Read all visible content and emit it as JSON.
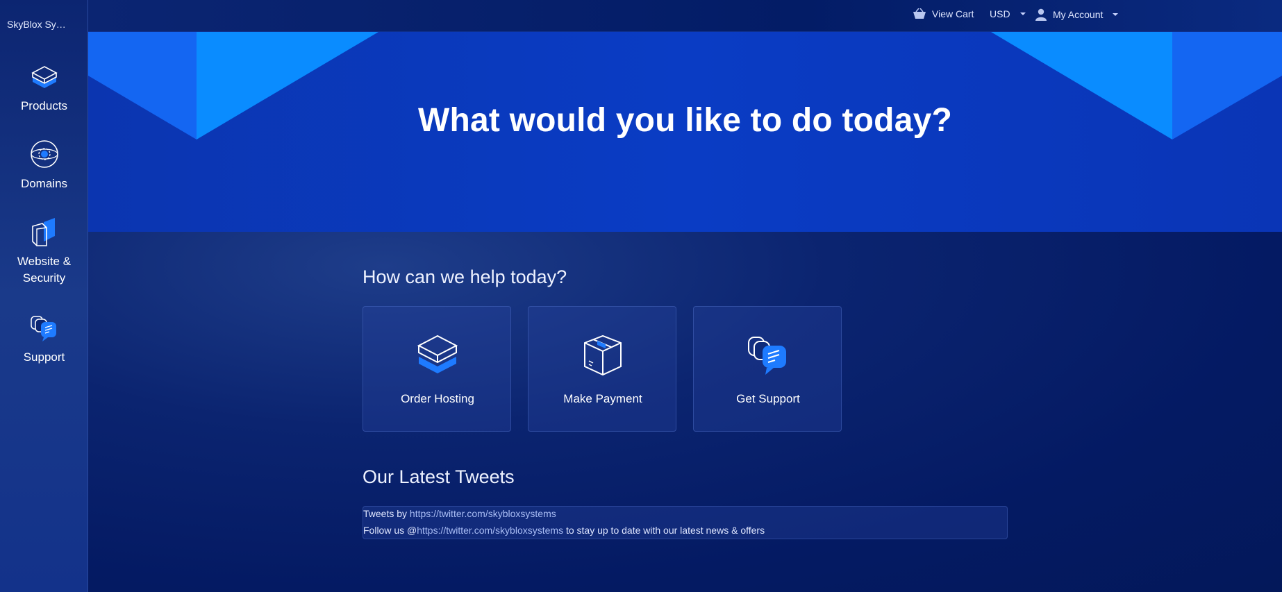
{
  "sidebar": {
    "brand": "SkyBlox Sy…",
    "items": [
      {
        "label": "Products",
        "icon": "box-icon"
      },
      {
        "label": "Domains",
        "icon": "globe-icon"
      },
      {
        "label": "Website &",
        "label2": "Security",
        "icon": "shield-book-icon"
      },
      {
        "label": "Support",
        "icon": "chat-bubbles-icon"
      }
    ]
  },
  "topbar": {
    "cart_label": "View Cart",
    "currency": "USD",
    "account_label": "My Account"
  },
  "hero": {
    "title": "What would you like to do today?"
  },
  "help": {
    "title": "How can we help today?",
    "cards": [
      {
        "label": "Order Hosting",
        "icon": "server-box-icon"
      },
      {
        "label": "Make Payment",
        "icon": "package-icon"
      },
      {
        "label": "Get Support",
        "icon": "chat-bubbles-icon"
      }
    ]
  },
  "tweets": {
    "title": "Our Latest Tweets",
    "line1_prefix": "Tweets by ",
    "line1_link": "https://twitter.com/skybloxsystems",
    "line2_prefix": "Follow us @",
    "line2_link": "https://twitter.com/skybloxsystems",
    "line2_suffix": " to stay up to date with our latest news & offers"
  },
  "colors": {
    "accent": "#0094ff",
    "hero_bg": "#0a3cc4",
    "page_bg": "#041a63"
  }
}
